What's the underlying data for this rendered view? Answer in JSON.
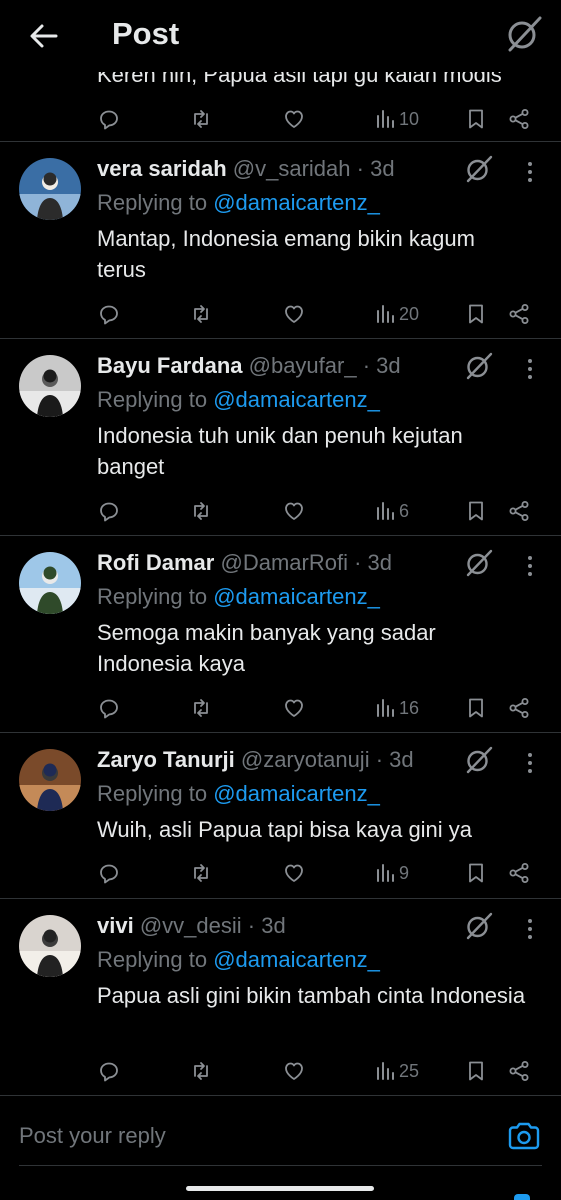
{
  "header": {
    "title": "Post"
  },
  "partial_post": {
    "text": "Keren nih, Papua asli tapi gu kalah modis",
    "views": "10"
  },
  "replying_label": "Replying to",
  "replies": [
    {
      "name": "vera saridah",
      "handle": "@v_saridah",
      "dot": "·",
      "time": "3d",
      "replying_to": "@damaicartenz_",
      "text": "Mantap, Indonesia emang bikin kagum terus",
      "views": "20"
    },
    {
      "name": "Bayu Fardana",
      "handle": "@bayufar_",
      "dot": "·",
      "time": "3d",
      "replying_to": "@damaicartenz_",
      "text": "Indonesia tuh unik dan penuh kejutan banget",
      "views": "6"
    },
    {
      "name": "Rofi Damar",
      "handle": "@DamarRofi",
      "dot": "·",
      "time": "3d",
      "replying_to": "@damaicartenz_",
      "text": "Semoga makin banyak yang sadar Indonesia kaya",
      "views": "16"
    },
    {
      "name": "Zaryo Tanurji",
      "handle": "@zaryotanuji",
      "dot": "·",
      "time": "3d",
      "replying_to": "@damaicartenz_",
      "text": "Wuih, asli Papua tapi bisa kaya gini ya",
      "views": "9"
    },
    {
      "name": "vivi",
      "handle": "@vv_desii",
      "dot": "·",
      "time": "3d",
      "replying_to": "@damaicartenz_",
      "text": "Papua asli gini bikin tambah cinta Indonesia",
      "views": "25"
    }
  ],
  "composer": {
    "placeholder": "Post your reply"
  },
  "icons": {
    "back": "arrow-left-icon",
    "grok": "grok-slash-icon",
    "more": "vertical-dots-icon",
    "reply": "speech-bubble-icon",
    "repost": "retweet-icon",
    "like": "heart-icon",
    "views": "bar-chart-icon",
    "bookmark": "bookmark-icon",
    "share": "share-icon",
    "camera": "camera-icon"
  },
  "colors": {
    "background": "#000000",
    "text": "#e7e9ea",
    "muted": "#71767b",
    "accent": "#1d9bf0",
    "divider": "#2f3336"
  }
}
